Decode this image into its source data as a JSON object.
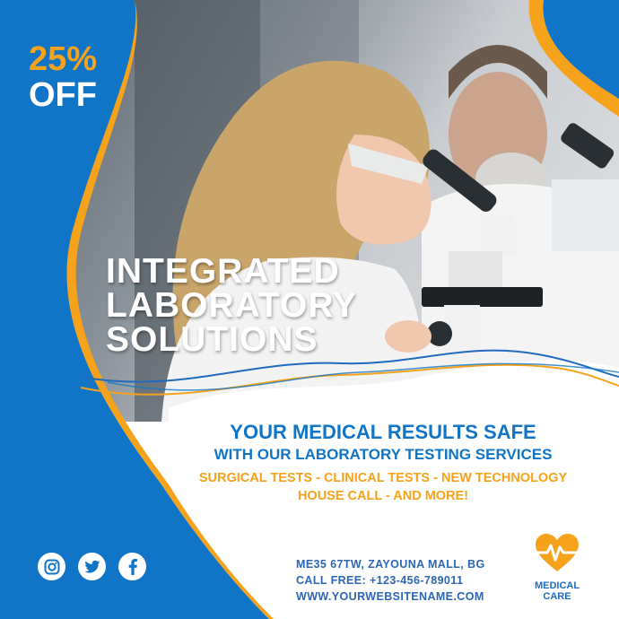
{
  "colors": {
    "blue": "#1175c7",
    "orange": "#f7a21b",
    "white": "#ffffff",
    "contact_blue": "#2d66b5"
  },
  "photo": {
    "description_icon": "lab-scientist-microscope-photo"
  },
  "promo": {
    "percent": "25%",
    "off": "OFF"
  },
  "headline": {
    "line1": "INTEGRATED",
    "line2": "LABORATORY",
    "line3": "SOLUTIONS"
  },
  "tagline": {
    "line1": "YOUR MEDICAL RESULTS SAFE",
    "line2": "WITH OUR LABORATORY TESTING SERVICES",
    "services1": "SURGICAL TESTS - CLINICAL TESTS - NEW TECHNOLOGY",
    "services2": "HOUSE CALL - AND MORE!"
  },
  "social": {
    "icons": [
      "instagram-icon",
      "twitter-icon",
      "facebook-icon"
    ]
  },
  "contact": {
    "address": "ME35 67TW, ZAYOUNA MALL, BG",
    "phone": "CALL FREE: +123-456-789011",
    "website": "WWW.YOURWEBSITENAME.COM"
  },
  "brand": {
    "icon": "heart-pulse-icon",
    "line1": "MEDICAL",
    "line2": "CARE"
  }
}
